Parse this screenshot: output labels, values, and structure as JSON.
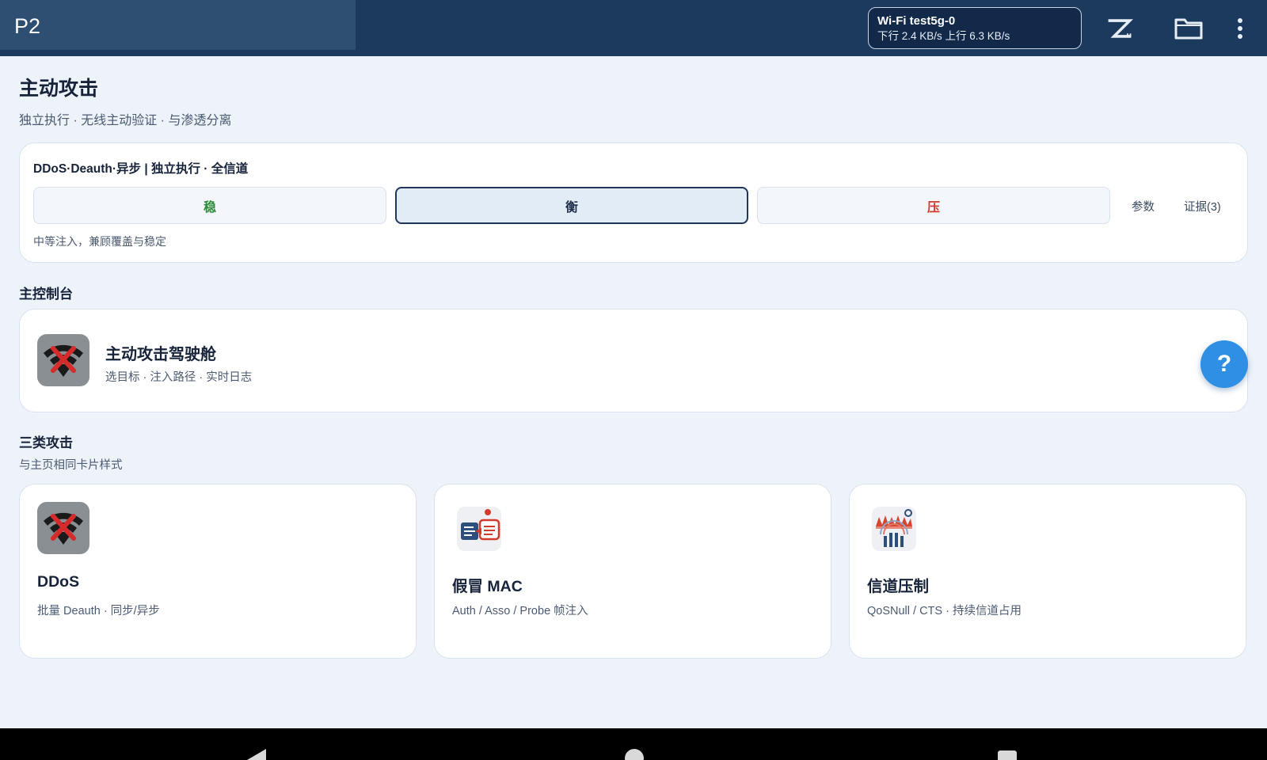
{
  "topbar": {
    "tab_label": "P2",
    "wifi": {
      "ssid": "Wi-Fi test5g-0",
      "speed": "下行 2.4 KB/s 上行 6.3 KB/s"
    },
    "icons": [
      "z-logo-icon",
      "folder-icon",
      "more-vert-icon"
    ]
  },
  "header": {
    "title": "主动攻击",
    "subtitle": "独立执行 · 无线主动验证 · 与渗透分离"
  },
  "mode_card": {
    "title": "DDoS·Deauth·异步 | 独立执行 · 全信道",
    "segments": [
      {
        "label": "稳",
        "color": "#2e8b3a"
      },
      {
        "label": "衡",
        "color": "#1c2d48",
        "selected": true
      },
      {
        "label": "压",
        "color": "#d23a2c"
      }
    ],
    "params_label": "参数",
    "evidence_label": "证据(3)",
    "description": "中等注入，兼顾覆盖与稳定"
  },
  "console_section": {
    "title": "主控制台",
    "card": {
      "icon": "wifi-deauth-icon",
      "title": "主动攻击驾驶舱",
      "subtitle": "选目标 · 注入路径 · 实时日志"
    }
  },
  "help_button": {
    "label": "?",
    "color": "#2f8fe4"
  },
  "attacks_section": {
    "title": "三类攻击",
    "subtitle": "与主页相同卡片样式",
    "cards": [
      {
        "icon": "wifi-deauth-icon",
        "title": "DDoS",
        "subtitle": "批量 Deauth · 同步/异步"
      },
      {
        "icon": "mac-spoof-icon",
        "title": "假冒 MAC",
        "subtitle": "Auth / Asso / Probe 帧注入"
      },
      {
        "icon": "channel-jam-icon",
        "title": "信道压制",
        "subtitle": "QoSNull / CTS · 持续信道占用"
      }
    ]
  },
  "colors": {
    "topbar": "#1b3a5e",
    "background": "#eef3fa",
    "accent": "#2f8fe4"
  }
}
